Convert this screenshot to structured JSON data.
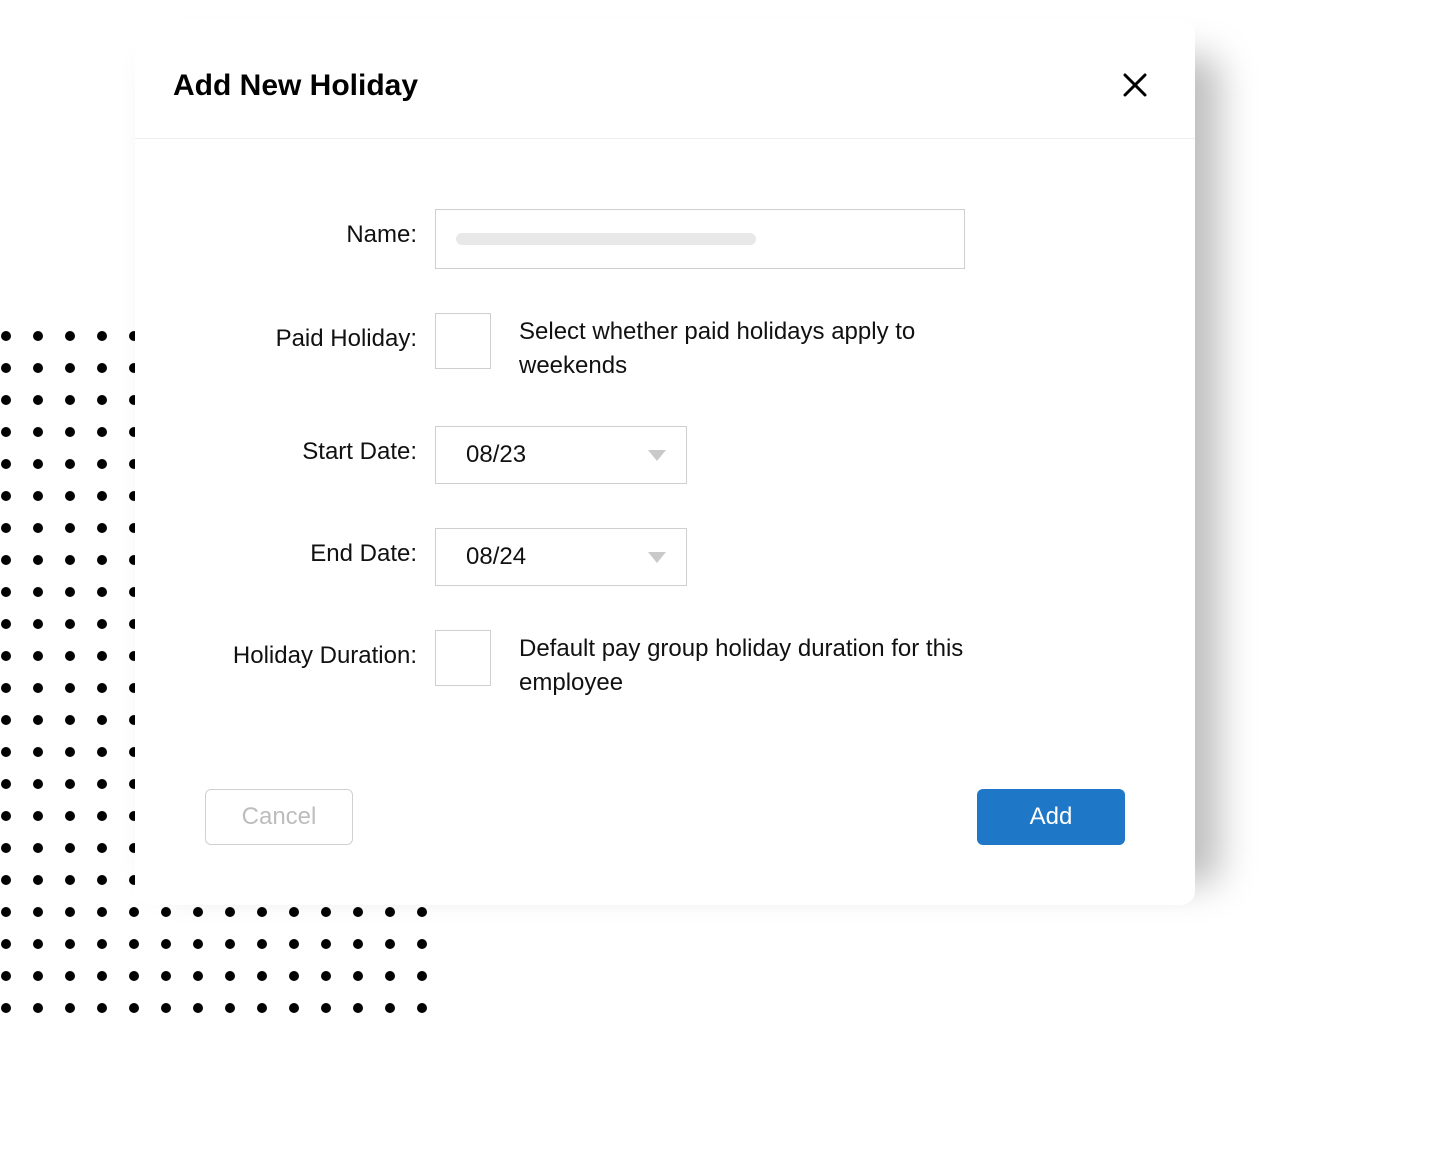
{
  "dialog": {
    "title": "Add New Holiday"
  },
  "form": {
    "name": {
      "label": "Name:",
      "value": ""
    },
    "paidHoliday": {
      "label": "Paid Holiday:",
      "helper": "Select whether paid holidays apply to weekends",
      "checked": false
    },
    "startDate": {
      "label": "Start Date:",
      "value": "08/23"
    },
    "endDate": {
      "label": "End Date:",
      "value": "08/24"
    },
    "holidayDuration": {
      "label": "Holiday Duration:",
      "helper": "Default pay group holiday duration for this employee",
      "checked": false
    }
  },
  "footer": {
    "cancel": "Cancel",
    "add": "Add"
  }
}
